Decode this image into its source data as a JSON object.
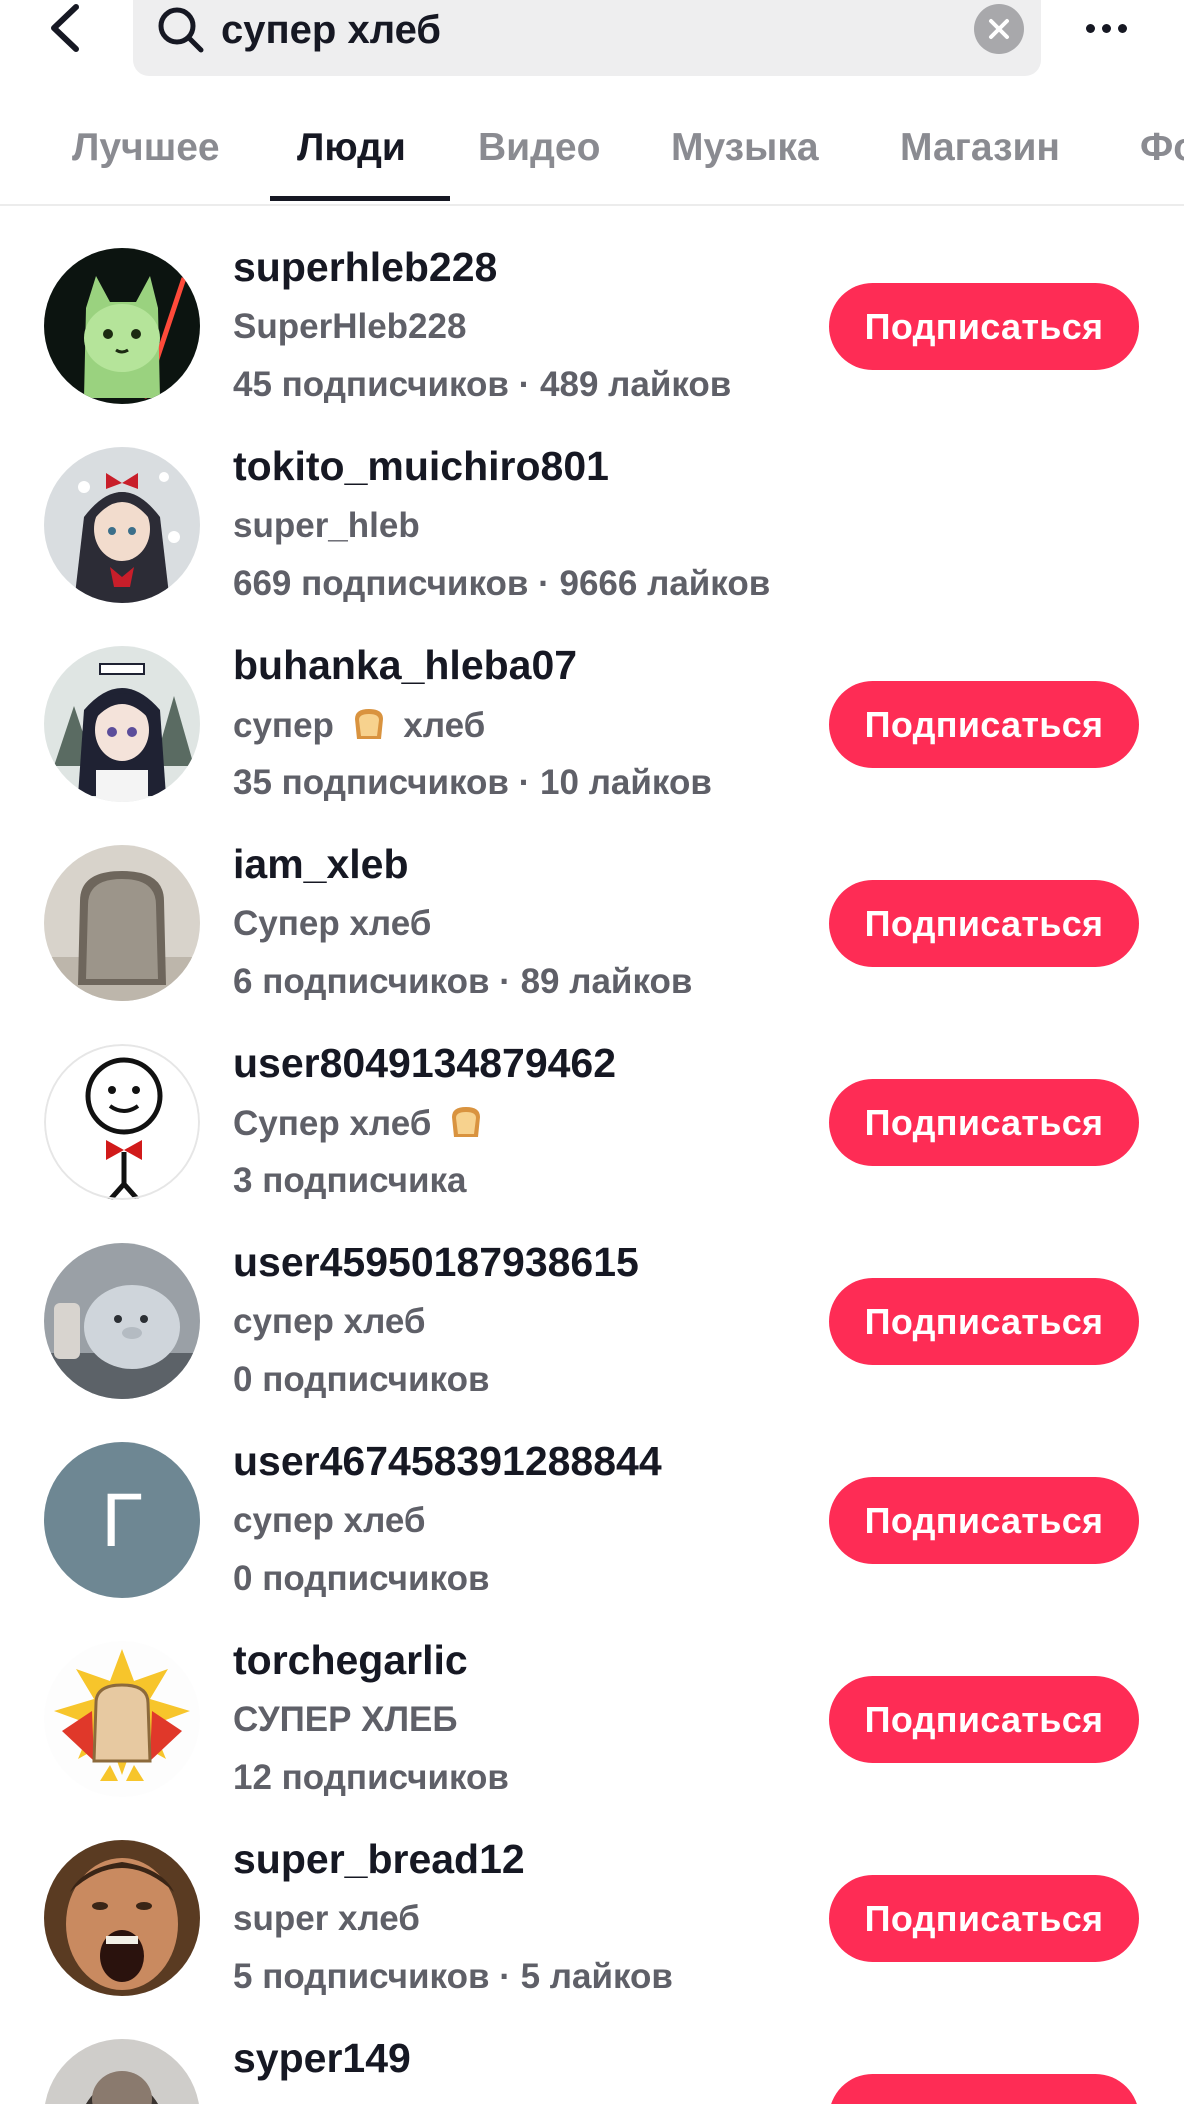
{
  "search": {
    "query": "супер хлеб"
  },
  "tabs": [
    {
      "label": "Лучшее",
      "active": false
    },
    {
      "label": "Люди",
      "active": true
    },
    {
      "label": "Видео",
      "active": false
    },
    {
      "label": "Музыка",
      "active": false
    },
    {
      "label": "Магазин",
      "active": false
    },
    {
      "label": "Фо",
      "active": false
    }
  ],
  "colors": {
    "accent": "#fe2c55",
    "text_primary": "#161823",
    "text_secondary": "#5f6068"
  },
  "users": [
    {
      "username": "superhleb228",
      "nickname": "SuperHleb228",
      "stats": "45 подписчиков · 489 лайков",
      "follow_label": "Подписаться",
      "avatar": "cat-avatar"
    },
    {
      "username": "tokito_muichiro801",
      "nickname": "super_hleb",
      "stats": "669 подписчиков · 9666 лайков",
      "follow_label": "",
      "avatar": "anime-girl-avatar"
    },
    {
      "username": "buhanka_hleba07",
      "nickname_before": "супер",
      "nickname_after": "хлеб",
      "nickname_icon": "bread-emoji",
      "stats": "35 подписчиков · 10 лайков",
      "follow_label": "Подписаться",
      "avatar": "anime-girl-avatar"
    },
    {
      "username": "iam_xleb",
      "nickname": "Супер хлеб",
      "stats": "6 подписчиков · 89 лайков",
      "follow_label": "Подписаться",
      "avatar": "bread-slice-avatar"
    },
    {
      "username": "user8049134879462",
      "nickname": "Супер хлеб",
      "nickname_icon": "bread-emoji",
      "stats": "3 подписчика",
      "follow_label": "Подписаться",
      "avatar": "stick-figure-avatar"
    },
    {
      "username": "user45950187938615",
      "nickname": "супер хлеб",
      "stats": "0 подписчиков",
      "follow_label": "Подписаться",
      "avatar": "seal-plush-avatar"
    },
    {
      "username": "user467458391288844",
      "nickname": "супер хлеб",
      "stats": "0 подписчиков",
      "follow_label": "Подписаться",
      "avatar_letter": "Г",
      "avatar": "letter-avatar"
    },
    {
      "username": "torchegarlic",
      "nickname": "СУПЕР ХЛЕБ",
      "stats": "12 подписчиков",
      "follow_label": "Подписаться",
      "avatar": "bread-hero-avatar"
    },
    {
      "username": "super_bread12",
      "nickname": "super хлеб",
      "stats": "5 подписчиков · 5 лайков",
      "follow_label": "Подписаться",
      "avatar": "screaming-man-avatar"
    },
    {
      "username": "syper149",
      "nickname": "",
      "stats": "",
      "follow_label": "",
      "avatar": "person-avatar"
    }
  ]
}
